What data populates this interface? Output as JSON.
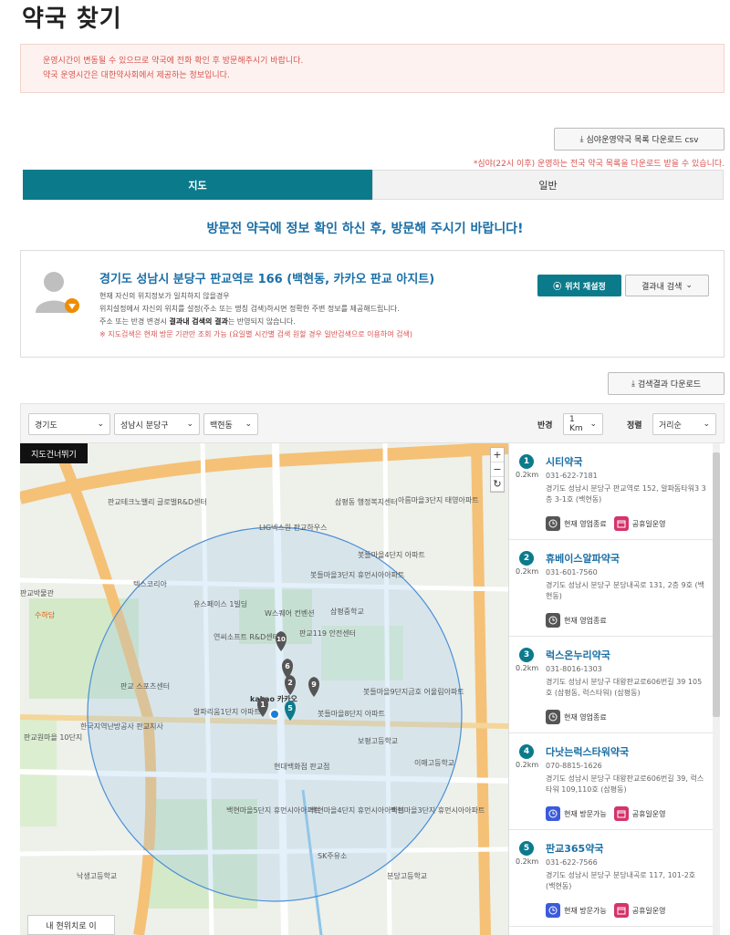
{
  "page": {
    "title": "약국 찾기"
  },
  "notice": {
    "line1": "운영시간이 변동될 수 있으므로 약국에 전화 확인 후 방문해주시기 바랍니다.",
    "line2": "약국 운영시간은 대한약사회에서 제공하는 정보입니다."
  },
  "csv": {
    "button_label": "심야운영약국 목록 다운로드 csv",
    "note": "*심야(22시 이후) 운영하는 전국 약국 목록을 다운로드 받을 수 있습니다."
  },
  "tabs": [
    {
      "label": "지도"
    },
    {
      "label": "일반"
    }
  ],
  "headline": "방문전 약국에 정보 확인 하신 후, 방문해 주시기 바랍니다!",
  "location": {
    "address": "경기도 성남시 분당구 판교역로 166 (백현동, 카카오 판교 아지트)",
    "line1": "현재 자신의 위치정보가 일치하지 않을경우",
    "line2": "위치설정에서 자신의 위치를 설정(주소 또는 명칭 검색)하시면 정확한 주변 정보를 제공해드립니다.",
    "line3_pre": "주소 또는 반경 변경시 ",
    "line3_bold": "결과내 검색의 결과",
    "line3_post": "는 반영되지 않습니다.",
    "line4": "※ 지도검색은 현재 방문 기관만 조회 가능 (요일별 시간별 검색 원할 경우 일반검색으로 이용하여 검색)",
    "reset_label": "위치 재설정",
    "in_search_label": "결과내 검색"
  },
  "download_results_label": "검색결과 다운로드",
  "filters": {
    "province": "경기도",
    "city": "성남시 분당구",
    "dong": "백현동",
    "radius_label": "반경",
    "radius": "1 Km",
    "sort_label": "정렬",
    "sort": "거리순"
  },
  "map": {
    "skip_label": "지도건너뛰기",
    "zoom_in": "+",
    "zoom_out": "−",
    "my_location_label": "내 현위치로 이",
    "center_label": "kakao 카카오",
    "labels": [
      "판교테크노밸리 글로벌R&D센터",
      "LIG넥스원 판교하우스",
      "봇들마을4단지 아파트",
      "삼평동 행정복지센터",
      "아름마을3단지 태영아파트",
      "텍스코리아",
      "봇들마을3단지 휴먼시아아파트",
      "유스페이스 1빌딩",
      "W스퀘어 컨벤션",
      "삼평중학교",
      "연씨소프트 R&D센터",
      "판교119 안전센터",
      "알파리움1단지 아파트",
      "봇들마을8단지 아파트",
      "봇들마을9단지금호 어울림아파트",
      "판교 스포츠센터",
      "한국지역난방공사 판교지사",
      "보평고등학교",
      "현대백화점 판교점",
      "백현마을5단지 휴먼시아아파트",
      "백현마을4단지 휴먼시아아파트",
      "백현마을3단지 휴먼시아아파트",
      "SK주유소",
      "분당고등학교",
      "이매고등학교",
      "판교원마을 10단지",
      "낙생고등학교",
      "판교박물관",
      "수하담"
    ],
    "markers": [
      "1",
      "2",
      "5",
      "6",
      "9",
      "10"
    ]
  },
  "pharmacies": [
    {
      "num": "1",
      "distance": "0.2km",
      "name": "시티약국",
      "phone": "031-622-7181",
      "address": "경기도 성남시 분당구 판교역로 152, 알파돔타워3 3층 3-1호 (백현동)",
      "status": "현재 영업종료",
      "holiday": "공휴일운영"
    },
    {
      "num": "2",
      "distance": "0.2km",
      "name": "휴베이스알파약국",
      "phone": "031-601-7560",
      "address": "경기도 성남시 분당구 분당내곡로 131, 2층 9호 (백현동)",
      "status": "현재 영업종료",
      "holiday": ""
    },
    {
      "num": "3",
      "distance": "0.2km",
      "name": "럭스온누리약국",
      "phone": "031-8016-1303",
      "address": "경기도 성남시 분당구 대왕판교로606번길 39 105호 (삼평동, 럭스타워) (삼평동)",
      "status": "현재 영업종료",
      "holiday": ""
    },
    {
      "num": "4",
      "distance": "0.2km",
      "name": "다낫는럭스타워약국",
      "phone": "070-8815-1626",
      "address": "경기도 성남시 분당구 대왕판교로606번길 39, 럭스타워 109,110호 (삼평동)",
      "status": "현재 방문가능",
      "holiday": "공휴일운영"
    },
    {
      "num": "5",
      "distance": "0.2km",
      "name": "판교365약국",
      "phone": "031-622-7566",
      "address": "경기도 성남시 분당구 분당내곡로 117, 101-2호 (백현동)",
      "status": "현재 방문가능",
      "holiday": "공휴일운영"
    }
  ]
}
